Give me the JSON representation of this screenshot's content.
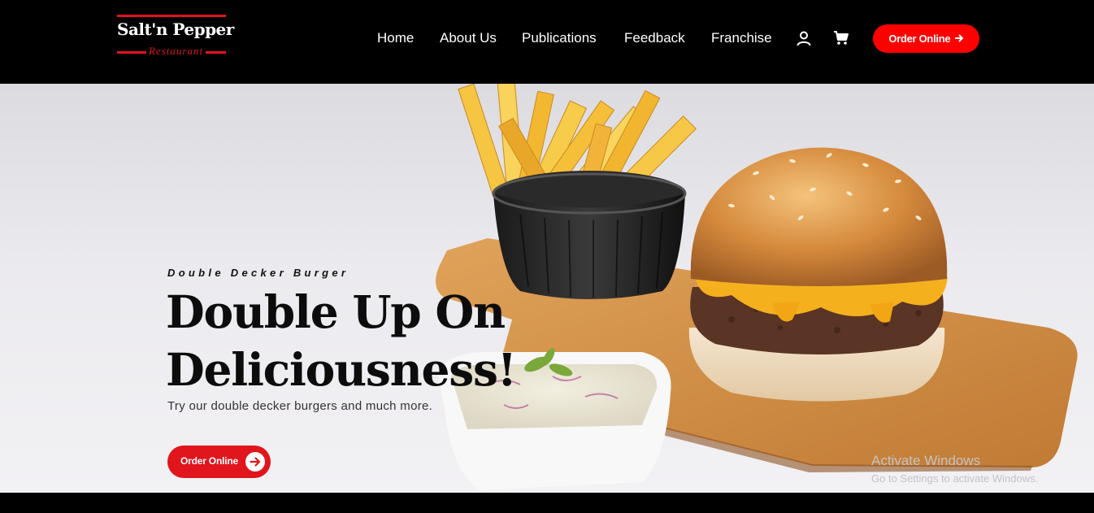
{
  "header": {
    "logo_text": "Salt'n Pepper",
    "logo_subtext": "Restaurant",
    "nav": [
      {
        "label": "Home"
      },
      {
        "label": "About Us"
      },
      {
        "label": "Publications"
      },
      {
        "label": "Feedback"
      },
      {
        "label": "Franchise"
      }
    ],
    "account_icon": "user-icon",
    "cart_icon": "shopping-cart-icon",
    "order_button": "Order Online",
    "order_button_icon": "arrow-right-icon"
  },
  "hero": {
    "eyebrow": "Double Decker Burger",
    "headline_line1": "Double Up On",
    "headline_line2": "Deliciousness!",
    "tagline": "Try our double decker burgers and much more.",
    "cta_label": "Order Online",
    "cta_icon": "arrow-right-circle-icon",
    "image": "burger-fries-coleslaw-photo"
  },
  "watermark": {
    "line1": "Activate Windows",
    "line2": "Go to Settings to activate Windows."
  },
  "colors": {
    "brand_red": "#e1151c",
    "cta_red": "#ff0000",
    "header_bg": "#000000"
  }
}
